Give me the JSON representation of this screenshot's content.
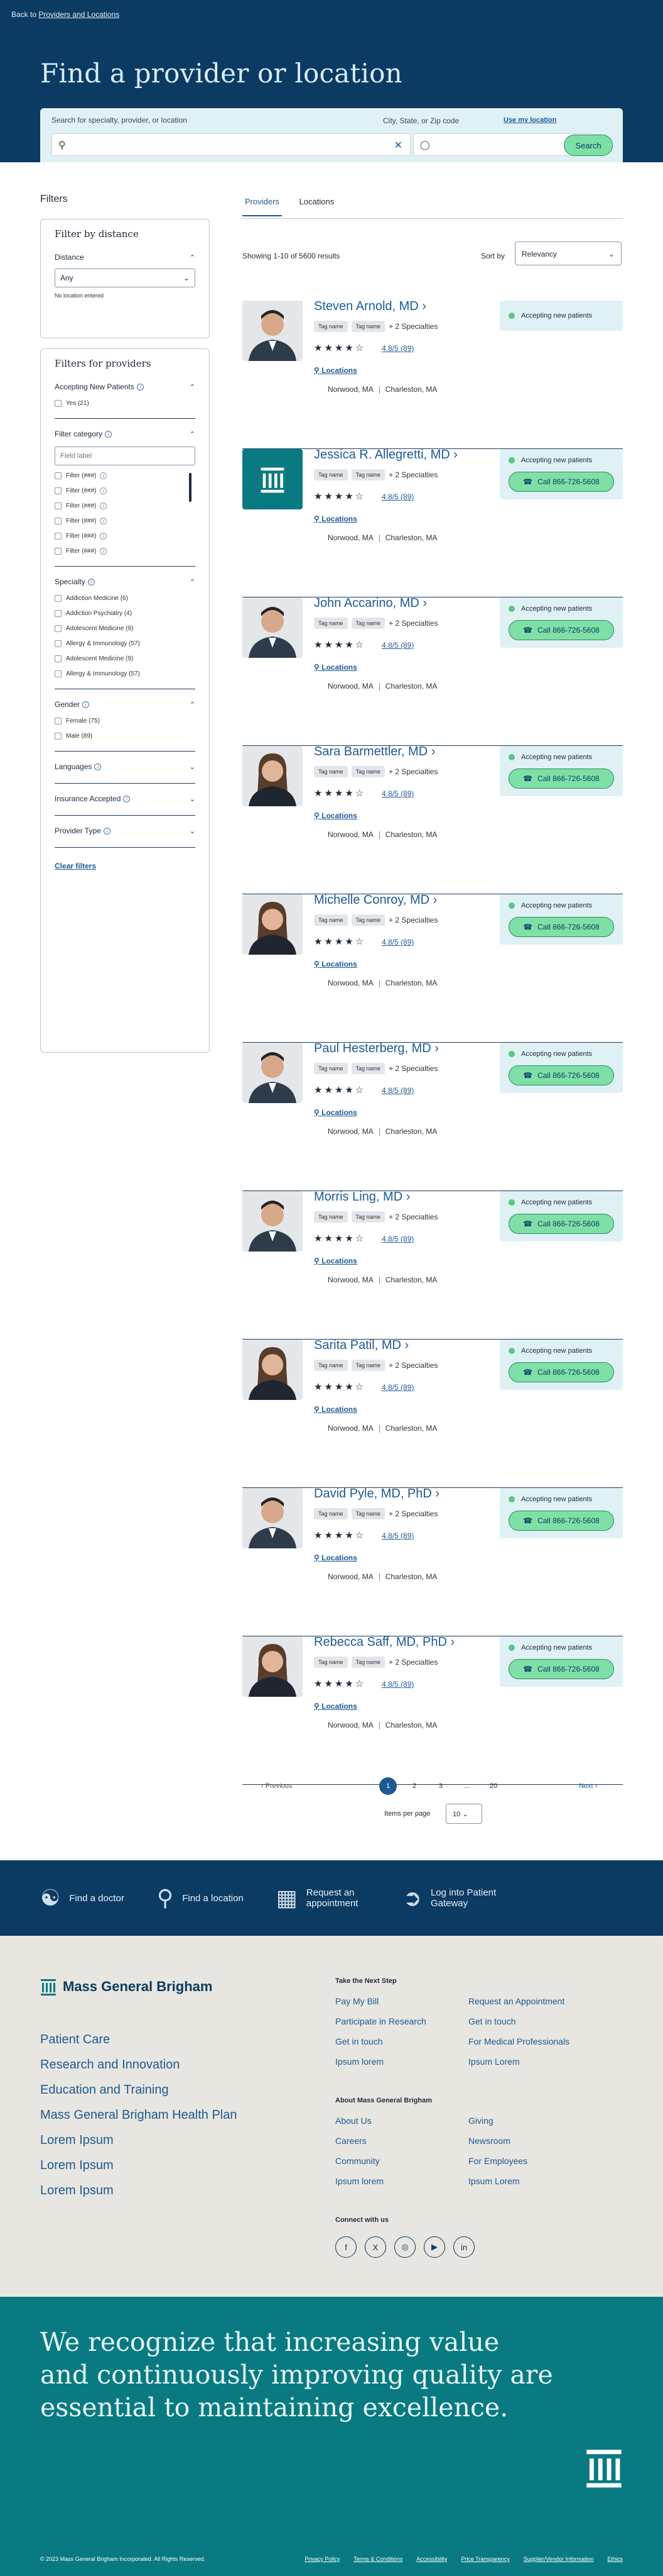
{
  "back": {
    "prefix": "Back to",
    "link": "Providers and Locations"
  },
  "hero": {
    "title": "Find a provider or location"
  },
  "search": {
    "label": "Search for specialty, provider, or location",
    "zip_label": "City, State, or Zip code",
    "use_location": "Use my location",
    "button": "Search"
  },
  "filters": {
    "heading": "Filters",
    "distance_box": {
      "title": "Filter by distance",
      "distance_label": "Distance",
      "distance_value": "Any",
      "note": "No location entered"
    },
    "providers_box": {
      "title": "Filters for providers",
      "accepting_label": "Accepting New Patients",
      "accepting_options": [
        "Yes (21)"
      ],
      "category_label": "Filter category",
      "field_placeholder": "Field label",
      "category_options": [
        "Filter (###)",
        "Filter (###)",
        "Filter (###)",
        "Filter (###)",
        "Filter (###)",
        "Filter (###)"
      ],
      "specialty_label": "Specialty",
      "specialty_options": [
        "Addiction Medicine (6)",
        "Addiction Psychiatry (4)",
        "Adolescent Medicine (9)",
        "Allergy & Immunology (57)",
        "Adolescent Medicine (9)",
        "Allergy & Immunology (57)"
      ],
      "gender_label": "Gender",
      "gender_options": [
        "Female (75)",
        "Male (89)"
      ],
      "languages_label": "Languages",
      "insurance_label": "Insurance Accepted",
      "provider_type_label": "Provider Type",
      "clear": "Clear filters"
    }
  },
  "tabs": [
    "Providers",
    "Locations"
  ],
  "results": {
    "showing": "Showing 1-10 of 5600 results",
    "sort_label": "Sort by",
    "sort_value": "Relevancy"
  },
  "common": {
    "tag": "Tag name",
    "more": "+ 2 Specialties",
    "rating": "4.8/5 (89)",
    "locations": "Locations",
    "loc1": "Norwood, MA",
    "loc2": "Charleston, MA",
    "accepting": "Accepting new patients",
    "call": "Call 866-726-5608"
  },
  "providers": [
    {
      "name": "Steven Arnold, MD",
      "photo": "male-portrait",
      "call": false
    },
    {
      "name": "Jessica R. Allegretti, MD",
      "photo": "brand-logo",
      "call": true
    },
    {
      "name": "John Accarino, MD",
      "photo": "male-portrait",
      "call": true
    },
    {
      "name": "Sara Barmettler, MD",
      "photo": "female-portrait",
      "call": true
    },
    {
      "name": "Michelle Conroy, MD",
      "photo": "female-portrait",
      "call": true
    },
    {
      "name": "Paul Hesterberg, MD",
      "photo": "male-portrait",
      "call": true
    },
    {
      "name": "Morris Ling, MD",
      "photo": "male-portrait",
      "call": true
    },
    {
      "name": "Sarita Patil, MD",
      "photo": "female-portrait",
      "call": true
    },
    {
      "name": "David Pyle, MD, PhD",
      "photo": "male-portrait",
      "call": true
    },
    {
      "name": "Rebecca Saff, MD, PhD",
      "photo": "female-portrait",
      "call": true
    }
  ],
  "pagination": {
    "prev": "Previous",
    "pages": [
      "1",
      "2",
      "3",
      "...",
      "20"
    ],
    "next": "Next",
    "items_label": "Items per page",
    "items_value": "10"
  },
  "quick_links": [
    "Find a doctor",
    "Find a location",
    "Request an appointment",
    "Log into Patient Gateway"
  ],
  "footer": {
    "brand": "Mass General Brigham",
    "main_links": [
      "Patient Care",
      "Research and Innovation",
      "Education and Training",
      "Mass General Brigham Health Plan",
      "Lorem Ipsum",
      "Lorem Ipsum",
      "Lorem Ipsum"
    ],
    "next_step_heading": "Take the Next Step",
    "next_step_col1": [
      "Pay My Bill",
      "Participate in Research",
      "Get in touch",
      "Ipsum lorem"
    ],
    "next_step_col2": [
      "Request an Appointment",
      "Get in touch",
      "For Medical Professionals",
      "Ipsum Lorem"
    ],
    "about_heading": "About Mass General Brigham",
    "about_col1": [
      "About Us",
      "Careers",
      "Community",
      "Ipsum lorem"
    ],
    "about_col2": [
      "Giving",
      "Newsroom",
      "For Employees",
      "Ipsum Lorem"
    ],
    "connect_heading": "Connect with us",
    "social": [
      "f",
      "X",
      "◎",
      "▶",
      "in"
    ]
  },
  "band": {
    "text": "We recognize that increasing value and continuously improving quality are essential to maintaining excellence.",
    "copyright": "© 2023 Mass General Brigham Incorporated. All Rights Reserved.",
    "legal": [
      "Privacy Policy",
      "Terms & Conditions",
      "Accessibility",
      "Price Transparency",
      "Supplier/Vendor Information",
      "Ethics"
    ]
  },
  "colors": {
    "navy": "#0b3b63",
    "teal": "#0a7a82",
    "link": "#1c5a94",
    "green": "#7ee0a6",
    "light": "#dff1f5"
  }
}
